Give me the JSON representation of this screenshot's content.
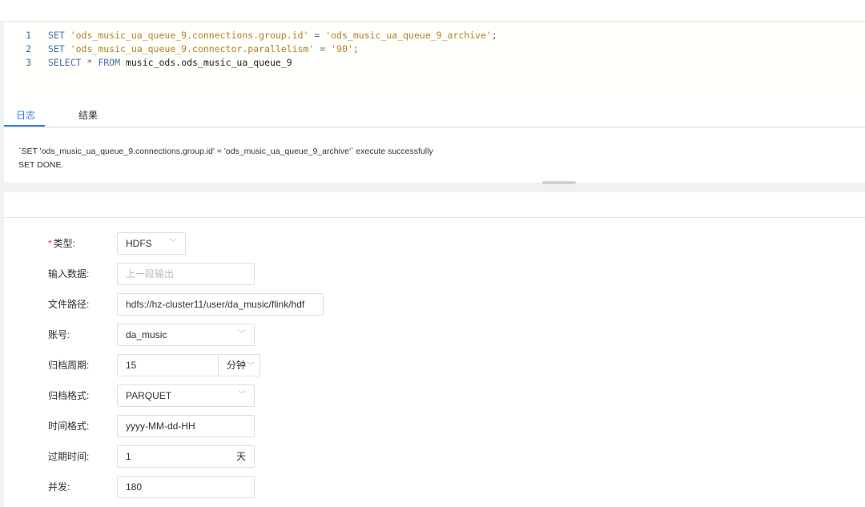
{
  "editor": {
    "lines": [
      {
        "num": "1",
        "tokens": [
          {
            "t": "kw",
            "v": "SET "
          },
          {
            "t": "str",
            "v": "'ods_music_ua_queue_9.connections.group.id'"
          },
          {
            "t": "op",
            "v": " = "
          },
          {
            "t": "str",
            "v": "'ods_music_ua_queue_9_archive'"
          },
          {
            "t": "op",
            "v": ";"
          }
        ]
      },
      {
        "num": "2",
        "tokens": [
          {
            "t": "kw",
            "v": "SET "
          },
          {
            "t": "str",
            "v": "'ods_music_ua_queue_9.connector.parallelism'"
          },
          {
            "t": "op",
            "v": " = "
          },
          {
            "t": "str",
            "v": "'90'"
          },
          {
            "t": "op",
            "v": ";"
          }
        ]
      },
      {
        "num": "3",
        "tokens": [
          {
            "t": "kw",
            "v": "SELECT "
          },
          {
            "t": "op",
            "v": "* "
          },
          {
            "t": "kw",
            "v": "FROM "
          },
          {
            "t": "plain",
            "v": "music_ods.ods_music_ua_queue_9"
          }
        ]
      }
    ]
  },
  "tabs": {
    "log": "日志",
    "result": "结果"
  },
  "log": {
    "line1": "`SET 'ods_music_ua_queue_9.connections.group.id' = 'ods_music_ua_queue_9_archive'` execute successfully",
    "line2": "SET DONE."
  },
  "form": {
    "type": {
      "label": "类型:",
      "required_mark": "*",
      "value": "HDFS"
    },
    "input": {
      "label": "输入数据:",
      "placeholder": "上一段输出"
    },
    "path": {
      "label": "文件路径:",
      "value": "hdfs://hz-cluster11/user/da_music/flink/hdf"
    },
    "account": {
      "label": "账号:",
      "value": "da_music"
    },
    "period": {
      "label": "归档周期:",
      "value": "15",
      "unit": "分钟"
    },
    "format": {
      "label": "归档格式:",
      "value": "PARQUET"
    },
    "time_format": {
      "label": "时间格式:",
      "value": "yyyy-MM-dd-HH"
    },
    "expire": {
      "label": "过期时间:",
      "value": "1",
      "unit": "天"
    },
    "concurrency": {
      "label": "并发:",
      "value": "180"
    }
  },
  "icons": {
    "chevron": "chevron-down-icon"
  },
  "colors": {
    "accent": "#2f7de1",
    "required": "#e53935",
    "sql_keyword": "#4a6fa5",
    "sql_string": "#b5802a",
    "line_number": "#237893"
  }
}
